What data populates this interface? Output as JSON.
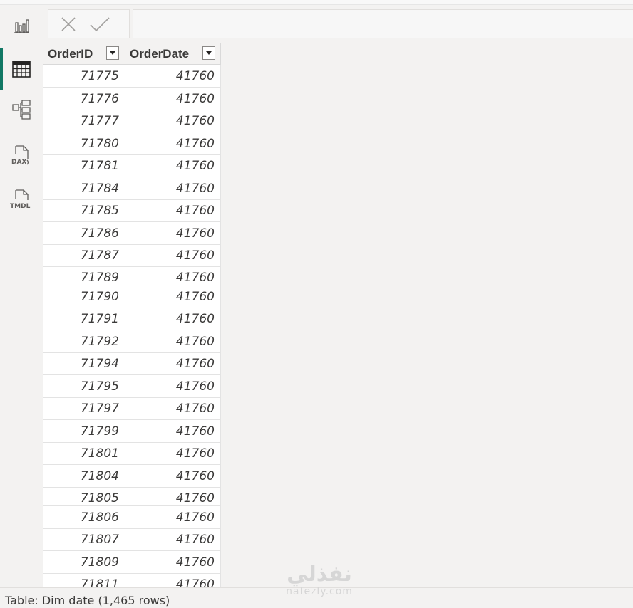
{
  "rail": {
    "items": [
      {
        "name": "report-view",
        "icon": "bar-chart-icon",
        "active": false
      },
      {
        "name": "table-view",
        "icon": "table-grid-icon",
        "active": true
      },
      {
        "name": "model-view",
        "icon": "model-diagram-icon",
        "active": false
      },
      {
        "name": "dax-query-view",
        "icon": "dax-document-icon",
        "label": "DAX",
        "active": false
      },
      {
        "name": "tmdl-view",
        "icon": "tmdl-document-icon",
        "label": "TMDL",
        "active": false
      }
    ]
  },
  "formula_bar": {
    "cancel_icon": "close-icon",
    "commit_icon": "check-icon"
  },
  "table": {
    "columns": [
      "OrderID",
      "OrderDate"
    ],
    "rows": [
      [
        "71775",
        "41760"
      ],
      [
        "71776",
        "41760"
      ],
      [
        "71777",
        "41760"
      ],
      [
        "71780",
        "41760"
      ],
      [
        "71781",
        "41760"
      ],
      [
        "71784",
        "41760"
      ],
      [
        "71785",
        "41760"
      ],
      [
        "71786",
        "41760"
      ],
      [
        "71787",
        "41760"
      ],
      [
        "71789",
        "41760"
      ],
      [
        "71790",
        "41760"
      ],
      [
        "71791",
        "41760"
      ],
      [
        "71792",
        "41760"
      ],
      [
        "71794",
        "41760"
      ],
      [
        "71795",
        "41760"
      ],
      [
        "71797",
        "41760"
      ],
      [
        "71799",
        "41760"
      ],
      [
        "71801",
        "41760"
      ],
      [
        "71804",
        "41760"
      ],
      [
        "71805",
        "41760"
      ],
      [
        "71806",
        "41760"
      ],
      [
        "71807",
        "41760"
      ],
      [
        "71809",
        "41760"
      ],
      [
        "71811",
        "41760"
      ]
    ]
  },
  "status": {
    "text": "Table: Dim date (1,465 rows)"
  },
  "watermark": {
    "arabic": "نفذلي",
    "latin": "nafezly.com"
  },
  "colors": {
    "accent": "#117865",
    "background": "#f3f2f1",
    "grid": "#ffffff",
    "text": "#3b3a39"
  }
}
